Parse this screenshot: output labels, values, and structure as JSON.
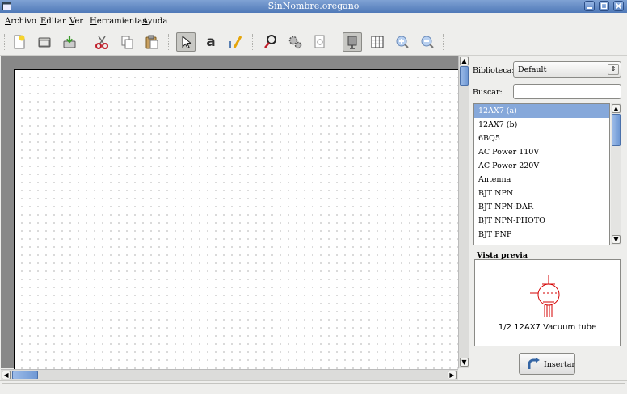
{
  "window": {
    "title": "SinNombre.oregano"
  },
  "menu": {
    "items": [
      "Archivo",
      "Editar",
      "Ver",
      "Herramientas",
      "Ayuda"
    ]
  },
  "toolbar": {
    "buttons": [
      "new-file-icon",
      "open-file-icon",
      "save-file-icon",
      "cut-icon",
      "copy-icon",
      "paste-icon",
      "pointer-tool-icon",
      "text-tool-icon",
      "wire-tool-icon",
      "voltmeter-icon",
      "settings-icon",
      "zoom-page-icon",
      "part-browser-icon",
      "grid-icon",
      "zoom-in-icon",
      "zoom-out-icon"
    ],
    "active": [
      "pointer-tool-icon",
      "part-browser-icon"
    ]
  },
  "sidebar": {
    "library_label": "Biblioteca:",
    "library_value": "Default",
    "search_label": "Buscar:",
    "search_value": "",
    "parts": [
      "12AX7 (a)",
      "12AX7 (b)",
      "6BQ5",
      "AC Power 110V",
      "AC Power 220V",
      "Antenna",
      "BJT NPN",
      "BJT NPN-DAR",
      "BJT NPN-PHOTO",
      "BJT PNP"
    ],
    "selected_part": "12AX7 (a)",
    "preview_title": "Vista previa",
    "preview_label": "1/2 12AX7 Vacuum tube",
    "insert_label": "Insertar"
  },
  "colors": {
    "selection": "#86a8da",
    "titlebar": "#5f86c2",
    "symbol": "#d40000"
  }
}
